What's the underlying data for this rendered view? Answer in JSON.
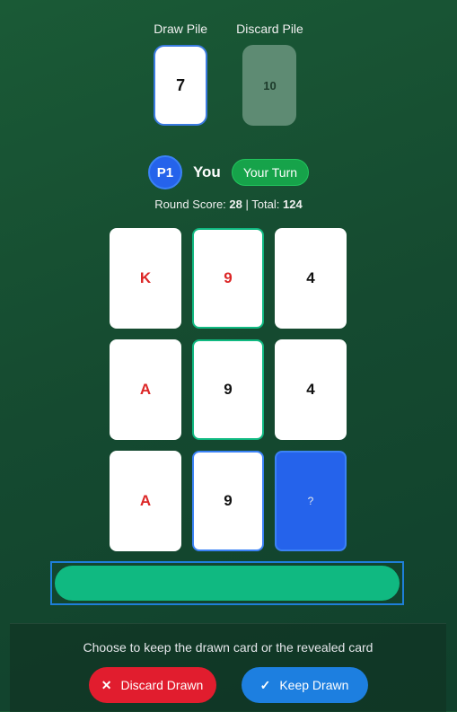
{
  "piles": {
    "draw": {
      "label": "Draw Pile",
      "value": "7"
    },
    "discard": {
      "label": "Discard Pile",
      "value": "10"
    }
  },
  "player": {
    "badge": "P1",
    "name": "You",
    "status": "Your Turn"
  },
  "score": {
    "round_label": "Round Score:",
    "round_value": "28",
    "separator": "|",
    "total_label": "Total:",
    "total_value": "124"
  },
  "grid": {
    "cards": [
      {
        "value": "K",
        "color": "#dc2626"
      },
      {
        "value": "9",
        "color": "#dc2626",
        "highlight": "green"
      },
      {
        "value": "4",
        "color": "#111111"
      },
      {
        "value": "A",
        "color": "#dc2626"
      },
      {
        "value": "9",
        "color": "#111111",
        "highlight": "green"
      },
      {
        "value": "4",
        "color": "#111111"
      },
      {
        "value": "A",
        "color": "#dc2626"
      },
      {
        "value": "9",
        "color": "#111111",
        "highlight": "blue"
      },
      {
        "value": "?",
        "face_down": true,
        "color": "#2563eb"
      }
    ]
  },
  "panel": {
    "instruction": "Choose to keep the drawn card or the revealed card",
    "discard_button": {
      "label": "Discard Drawn",
      "icon": "close-icon",
      "glyph": "✕",
      "color": "#e11d2e"
    },
    "keep_button": {
      "label": "Keep Drawn",
      "icon": "check-icon",
      "glyph": "✓",
      "color": "#1d7fe0"
    }
  },
  "colors": {
    "accent_green": "#10b981",
    "accent_blue": "#2563eb",
    "background": "#154a30"
  }
}
